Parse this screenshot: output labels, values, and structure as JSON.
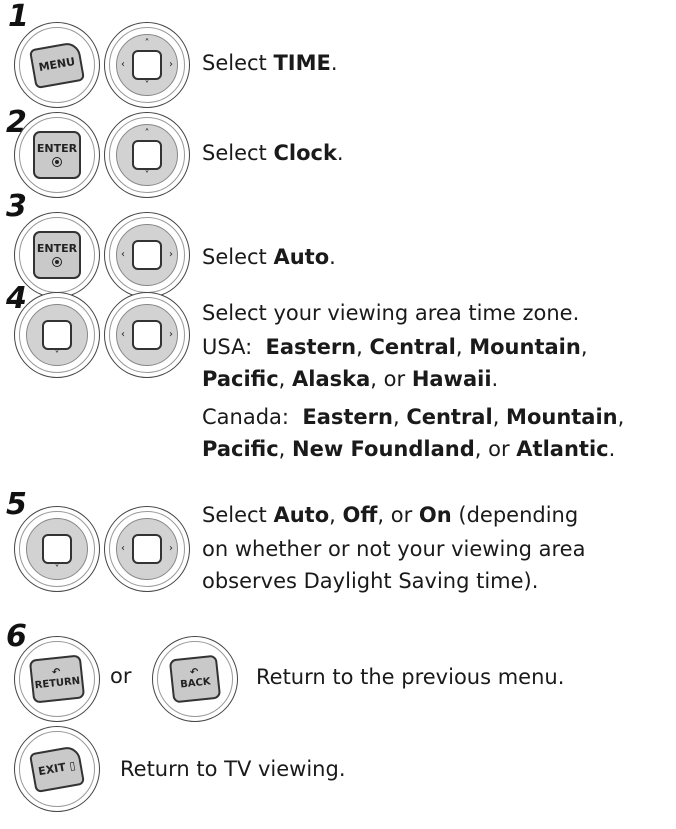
{
  "steps": [
    {
      "number": "1",
      "pre": "Select ",
      "bold": "TIME",
      "post": "."
    },
    {
      "number": "2",
      "pre": "Select ",
      "bold": "Clock",
      "post": "."
    },
    {
      "number": "3",
      "pre": "Select ",
      "bold": "Auto",
      "post": "."
    },
    {
      "number": "4",
      "line1": "Select your viewing area time zone.",
      "usa_label": "USA:",
      "usa_zones": [
        "Eastern",
        "Central",
        "Mountain",
        "Pacific",
        "Alaska",
        "Hawaii"
      ],
      "canada_label": "Canada:",
      "canada_zones": [
        "Eastern",
        "Central",
        "Mountain",
        "Pacific",
        "New Foundland",
        "Atlantic"
      ]
    },
    {
      "number": "5",
      "line1_pre": "Select ",
      "opt1": "Auto",
      "opt2": "Off",
      "opt3": "On",
      "line1_post": "(depending",
      "line2": "on whether or not your viewing area",
      "line3": "observes Daylight Saving time)."
    },
    {
      "number": "6",
      "or": "or",
      "text": "Return to the previous menu."
    },
    {
      "text": "Return to TV viewing."
    }
  ],
  "keys": {
    "menu": "MENU",
    "enter": "ENTER",
    "return": "RETURN",
    "back": "BACK",
    "exit": "EXIT"
  },
  "icons": [
    "menu-key-icon",
    "enter-key-icon",
    "nav-pad-icon",
    "return-key-icon",
    "back-key-icon",
    "exit-key-icon"
  ]
}
